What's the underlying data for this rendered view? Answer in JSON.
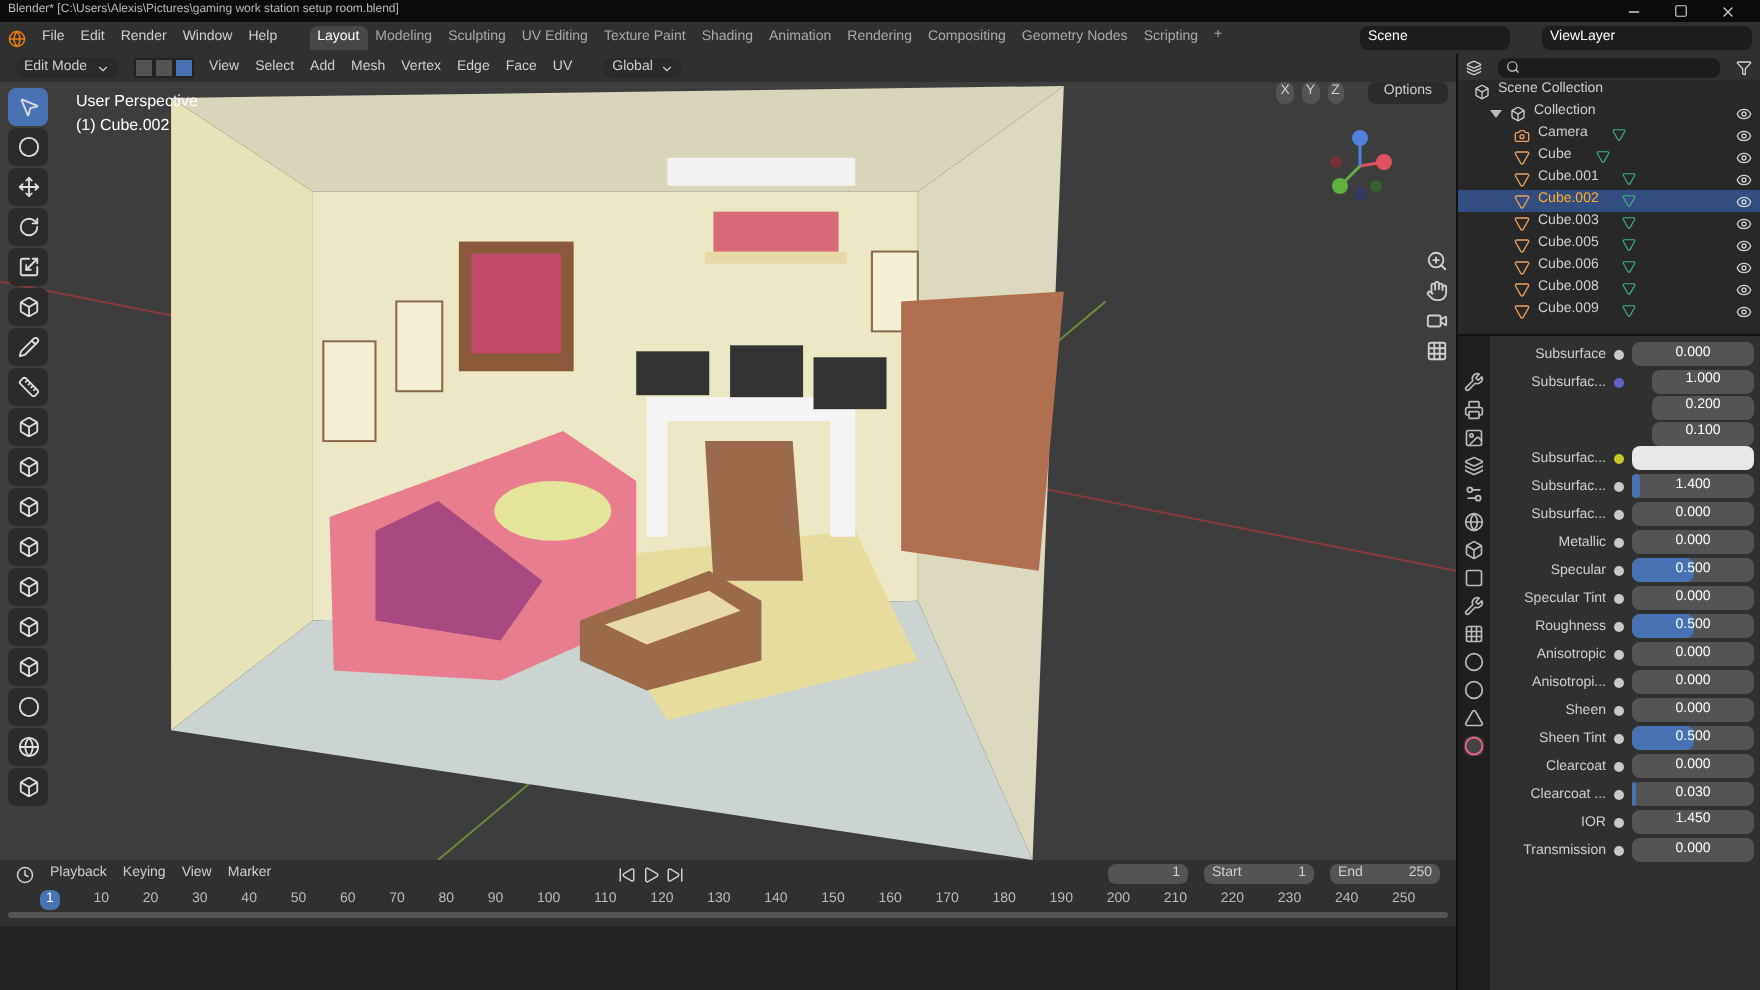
{
  "window": {
    "title": "Blender* [C:\\Users\\Alexis\\Pictures\\gaming work station setup room.blend]"
  },
  "menu": [
    "File",
    "Edit",
    "Render",
    "Window",
    "Help"
  ],
  "workspaces": [
    {
      "label": "Layout",
      "selected": true
    },
    {
      "label": "Modeling",
      "selected": false
    },
    {
      "label": "Sculpting",
      "selected": false
    },
    {
      "label": "UV Editing",
      "selected": false
    },
    {
      "label": "Texture Paint",
      "selected": false
    },
    {
      "label": "Shading",
      "selected": false
    },
    {
      "label": "Animation",
      "selected": false
    },
    {
      "label": "Rendering",
      "selected": false
    },
    {
      "label": "Compositing",
      "selected": false
    },
    {
      "label": "Geometry Nodes",
      "selected": false
    },
    {
      "label": "Scripting",
      "selected": false
    }
  ],
  "add_workspace": "+",
  "scene": "Scene",
  "view_layer": "ViewLayer",
  "viewport_header": {
    "mode": "Edit Mode",
    "select_modes": [
      {
        "selected": false
      },
      {
        "selected": false
      },
      {
        "selected": true
      }
    ],
    "menus": [
      "View",
      "Select",
      "Add",
      "Mesh",
      "Vertex",
      "Edge",
      "Face",
      "UV"
    ],
    "orientation": "Global",
    "axes": [
      "X",
      "Y",
      "Z"
    ],
    "options": "Options"
  },
  "viewport": {
    "view_name": "User Perspective",
    "object": "(1) Cube.002"
  },
  "tools": [
    {
      "selected": true
    },
    {
      "selected": false
    },
    {
      "selected": false
    },
    {
      "selected": false
    },
    {
      "selected": false
    },
    {
      "selected": false
    },
    {
      "selected": false
    },
    {
      "selected": false
    },
    {
      "selected": false
    },
    {
      "selected": false
    },
    {
      "selected": false
    },
    {
      "selected": false
    },
    {
      "selected": false
    },
    {
      "selected": false
    },
    {
      "selected": false
    },
    {
      "selected": false
    },
    {
      "selected": false
    },
    {
      "selected": false
    }
  ],
  "outliner": {
    "root": "Scene Collection",
    "collection": {
      "label": "Collection",
      "expanded": true,
      "children": [
        {
          "label": "Camera",
          "kind": "camera",
          "selected": false
        },
        {
          "label": "Cube",
          "kind": "mesh",
          "selected": false
        },
        {
          "label": "Cube.001",
          "kind": "mesh",
          "selected": false
        },
        {
          "label": "Cube.002",
          "kind": "mesh",
          "selected": true
        },
        {
          "label": "Cube.003",
          "kind": "mesh",
          "selected": false
        },
        {
          "label": "Cube.005",
          "kind": "mesh",
          "selected": false
        },
        {
          "label": "Cube.006",
          "kind": "mesh",
          "selected": false
        },
        {
          "label": "Cube.008",
          "kind": "mesh",
          "selected": false
        },
        {
          "label": "Cube.009",
          "kind": "mesh",
          "selected": false
        }
      ]
    }
  },
  "properties": [
    {
      "label": "Subsurface",
      "kind": "slider",
      "color": "#c8c8c8",
      "value": "0.000",
      "level": 0
    },
    {
      "label": "Subsurfac...",
      "kind": "vector",
      "color": "#6363c7",
      "values": [
        "1.000",
        "0.200",
        "0.100"
      ]
    },
    {
      "label": "Subsurfac...",
      "kind": "color",
      "color": "#c7c729"
    },
    {
      "label": "Subsurfac...",
      "kind": "slider",
      "color": "#c8c8c8",
      "value": "1.400",
      "level": 0.07
    },
    {
      "label": "Subsurfac...",
      "kind": "slider",
      "color": "#c8c8c8",
      "value": "0.000",
      "level": 0
    },
    {
      "label": "Metallic",
      "kind": "slider",
      "color": "#c8c8c8",
      "value": "0.000",
      "level": 0
    },
    {
      "label": "Specular",
      "kind": "slider",
      "color": "#c8c8c8",
      "value": "0.500",
      "level": 0.5
    },
    {
      "label": "Specular Tint",
      "kind": "slider",
      "color": "#c8c8c8",
      "value": "0.000",
      "level": 0
    },
    {
      "label": "Roughness",
      "kind": "slider",
      "color": "#c8c8c8",
      "value": "0.500",
      "level": 0.5
    },
    {
      "label": "Anisotropic",
      "kind": "slider",
      "color": "#c8c8c8",
      "value": "0.000",
      "level": 0
    },
    {
      "label": "Anisotropi...",
      "kind": "slider",
      "color": "#c8c8c8",
      "value": "0.000",
      "level": 0
    },
    {
      "label": "Sheen",
      "kind": "slider",
      "color": "#c8c8c8",
      "value": "0.000",
      "level": 0
    },
    {
      "label": "Sheen Tint",
      "kind": "slider",
      "color": "#c8c8c8",
      "value": "0.500",
      "level": 0.5
    },
    {
      "label": "Clearcoat",
      "kind": "slider",
      "color": "#c8c8c8",
      "value": "0.000",
      "level": 0
    },
    {
      "label": "Clearcoat ...",
      "kind": "slider",
      "color": "#c8c8c8",
      "value": "0.030",
      "level": 0.03
    },
    {
      "label": "IOR",
      "kind": "number",
      "color": "#c8c8c8",
      "value": "1.450"
    },
    {
      "label": "Transmission",
      "kind": "slider",
      "color": "#c8c8c8",
      "value": "0.000",
      "level": 0
    }
  ],
  "property_tabs": [
    {
      "selected": false
    },
    {
      "selected": false
    },
    {
      "selected": false
    },
    {
      "selected": false
    },
    {
      "selected": false
    },
    {
      "selected": false
    },
    {
      "selected": false
    },
    {
      "selected": false
    },
    {
      "selected": false
    },
    {
      "selected": false
    },
    {
      "selected": false
    },
    {
      "selected": false
    },
    {
      "selected": false
    },
    {
      "selected": true
    }
  ],
  "timeline": {
    "menus": [
      "Playback",
      "Keying",
      "View",
      "Marker"
    ],
    "current_frame": "1",
    "start_label": "Start",
    "start": "1",
    "end_label": "End",
    "end": "250",
    "ticks": [
      {
        "label": "1",
        "selected": true
      },
      {
        "label": "10",
        "selected": false
      },
      {
        "label": "20",
        "selected": false
      },
      {
        "label": "30",
        "selected": false
      },
      {
        "label": "40",
        "selected": false
      },
      {
        "label": "50",
        "selected": false
      },
      {
        "label": "60",
        "selected": false
      },
      {
        "label": "70",
        "selected": false
      },
      {
        "label": "80",
        "selected": false
      },
      {
        "label": "90",
        "selected": false
      },
      {
        "label": "100",
        "selected": false
      },
      {
        "label": "110",
        "selected": false
      },
      {
        "label": "120",
        "selected": false
      },
      {
        "label": "130",
        "selected": false
      },
      {
        "label": "140",
        "selected": false
      },
      {
        "label": "150",
        "selected": false
      },
      {
        "label": "160",
        "selected": false
      },
      {
        "label": "170",
        "selected": false
      },
      {
        "label": "180",
        "selected": false
      },
      {
        "label": "190",
        "selected": false
      },
      {
        "label": "200",
        "selected": false
      },
      {
        "label": "210",
        "selected": false
      },
      {
        "label": "220",
        "selected": false
      },
      {
        "label": "230",
        "selected": false
      },
      {
        "label": "240",
        "selected": false
      },
      {
        "label": "250",
        "selected": false
      }
    ]
  }
}
